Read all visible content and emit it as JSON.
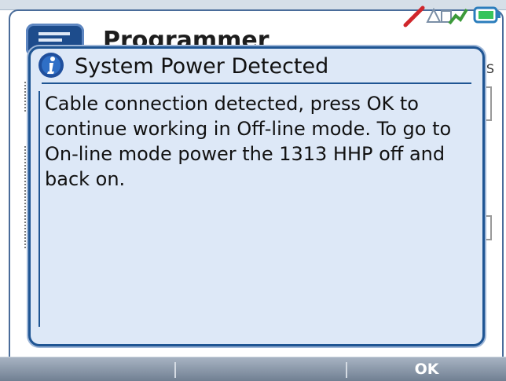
{
  "app": {
    "title": "Programmer",
    "side_label": "S"
  },
  "status_icons": [
    "no-signal-icon",
    "handheld-pair-icon",
    "battery-icon"
  ],
  "dialog": {
    "icon": "info-icon",
    "title": "System Power Detected",
    "message": "Cable connection detected, press OK to continue working in Off-line mode.  To go to On-line mode power the 1313 HHP off and back on."
  },
  "softkeys": {
    "left": "",
    "middle": "",
    "right": "OK"
  },
  "colors": {
    "dialog_bg": "#dde8f7",
    "dialog_border": "#1f5593",
    "softkey_bar": "#7b889a"
  }
}
